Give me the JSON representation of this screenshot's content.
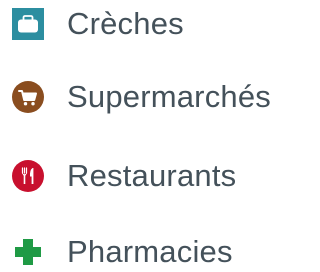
{
  "legend": {
    "items": [
      {
        "label": "Crèches",
        "icon": "briefcase-icon",
        "color": "#2c8ea0"
      },
      {
        "label": "Supermarchés",
        "icon": "shopping-cart-icon",
        "color": "#8a4d1f"
      },
      {
        "label": "Restaurants",
        "icon": "fork-knife-icon",
        "color": "#c8102e"
      },
      {
        "label": "Pharmacies",
        "icon": "plus-cross-icon",
        "color": "#1f9a45"
      }
    ]
  }
}
